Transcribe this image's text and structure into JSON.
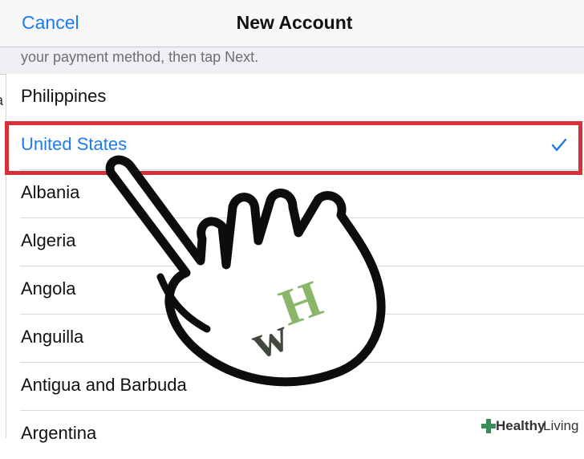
{
  "navbar": {
    "cancel_label": "Cancel",
    "title": "New Account"
  },
  "instruction": "your payment method, then tap Next.",
  "left_fragment": "a",
  "countries": [
    {
      "label": "Philippines",
      "selected": false
    },
    {
      "label": "United States",
      "selected": true
    },
    {
      "label": "Albania",
      "selected": false
    },
    {
      "label": "Algeria",
      "selected": false
    },
    {
      "label": "Angola",
      "selected": false
    },
    {
      "label": "Anguilla",
      "selected": false
    },
    {
      "label": "Antigua and Barbuda",
      "selected": false
    },
    {
      "label": "Argentina",
      "selected": false
    }
  ],
  "watermark": {
    "logo_text": "wH",
    "badge_bold": "Healthy",
    "badge_light": "Living"
  },
  "colors": {
    "accent": "#1a7cf0",
    "highlight": "#d8303a",
    "logo_green": "#8ab66a",
    "logo_dark": "#3f4a3c"
  },
  "icons": {
    "check": "checkmark-icon",
    "hand": "pointing-hand-icon"
  }
}
